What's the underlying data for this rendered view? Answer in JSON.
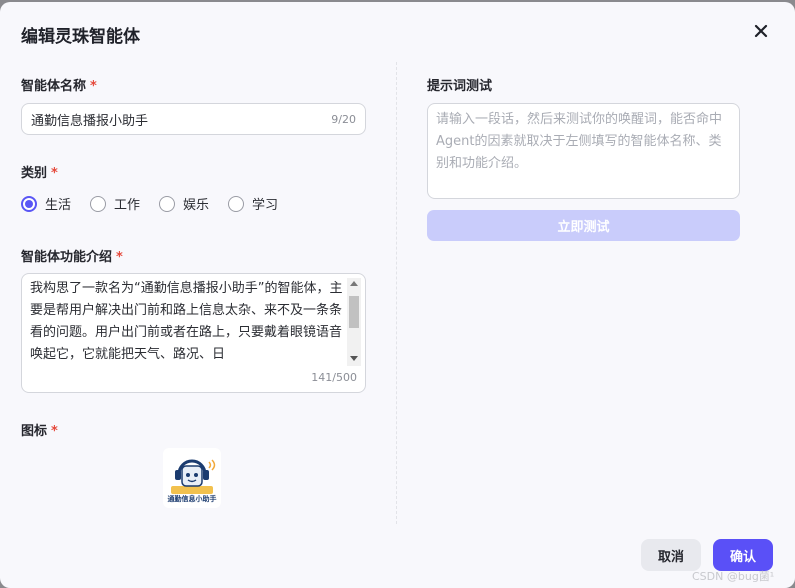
{
  "dialog": {
    "title": "编辑灵珠智能体"
  },
  "name_field": {
    "label": "智能体名称",
    "required_mark": "*",
    "value": "通勤信息播报小助手",
    "counter": "9/20"
  },
  "category": {
    "label": "类别",
    "required_mark": "*",
    "options": [
      {
        "label": "生活",
        "checked": true
      },
      {
        "label": "工作",
        "checked": false
      },
      {
        "label": "娱乐",
        "checked": false
      },
      {
        "label": "学习",
        "checked": false
      }
    ]
  },
  "intro_field": {
    "label": "智能体功能介绍",
    "required_mark": "*",
    "value": "我构思了一款名为“通勤信息播报小助手”的智能体，主要是帮用户解决出门前和路上信息太杂、来不及一条条看的问题。用户出门前或者在路上，只要戴着眼镜语音唤起它，它就能把天气、路况、日",
    "counter": "141/500"
  },
  "icon_field": {
    "label": "图标",
    "required_mark": "*",
    "image_text": "通勤信息小助手"
  },
  "prompt_test": {
    "label": "提示词测试",
    "placeholder": "请输入一段话，然后来测试你的唤醒词，能否命中Agent的因素就取决于左侧填写的智能体名称、类别和功能介绍。",
    "test_button": "立即测试"
  },
  "footer": {
    "cancel_label": "取消",
    "confirm_label": "确认"
  },
  "watermark": "CSDN @bug菌¹",
  "colors": {
    "accent": "#5a50f7",
    "required": "#e5483a",
    "disabled_button": "#c9ccfb"
  }
}
